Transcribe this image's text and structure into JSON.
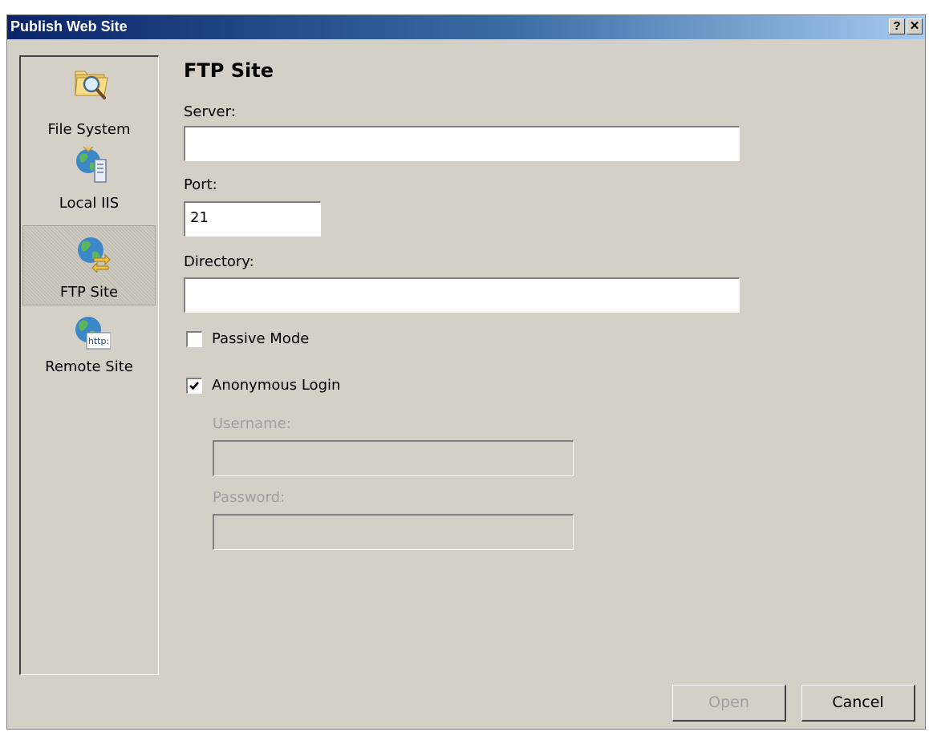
{
  "window": {
    "title": "Publish Web Site",
    "help_glyph": "?",
    "close_glyph": "✕"
  },
  "sidebar": {
    "items": [
      {
        "label": "File System",
        "icon": "folder-search-icon",
        "selected": false
      },
      {
        "label": "Local IIS",
        "icon": "globe-server-icon",
        "selected": false
      },
      {
        "label": "FTP Site",
        "icon": "globe-transfer-icon",
        "selected": true
      },
      {
        "label": "Remote Site",
        "icon": "globe-http-icon",
        "selected": false
      }
    ],
    "http_icon_text": "http:"
  },
  "form": {
    "section_title": "FTP Site",
    "server": {
      "label": "Server:",
      "value": ""
    },
    "port": {
      "label": "Port:",
      "value": "21"
    },
    "directory": {
      "label": "Directory:",
      "value": ""
    },
    "passive_mode": {
      "label": "Passive Mode",
      "checked": false
    },
    "anonymous_login": {
      "label": "Anonymous Login",
      "checked": true
    },
    "username": {
      "label": "Username:",
      "value": "",
      "disabled": true
    },
    "password": {
      "label": "Password:",
      "value": "",
      "disabled": true
    }
  },
  "buttons": {
    "open_label": "Open",
    "open_disabled": true,
    "cancel_label": "Cancel"
  },
  "colors": {
    "titlebar_start": "#0a246a",
    "titlebar_end": "#a6caf0",
    "dialog_bg": "#d4d0c8"
  }
}
